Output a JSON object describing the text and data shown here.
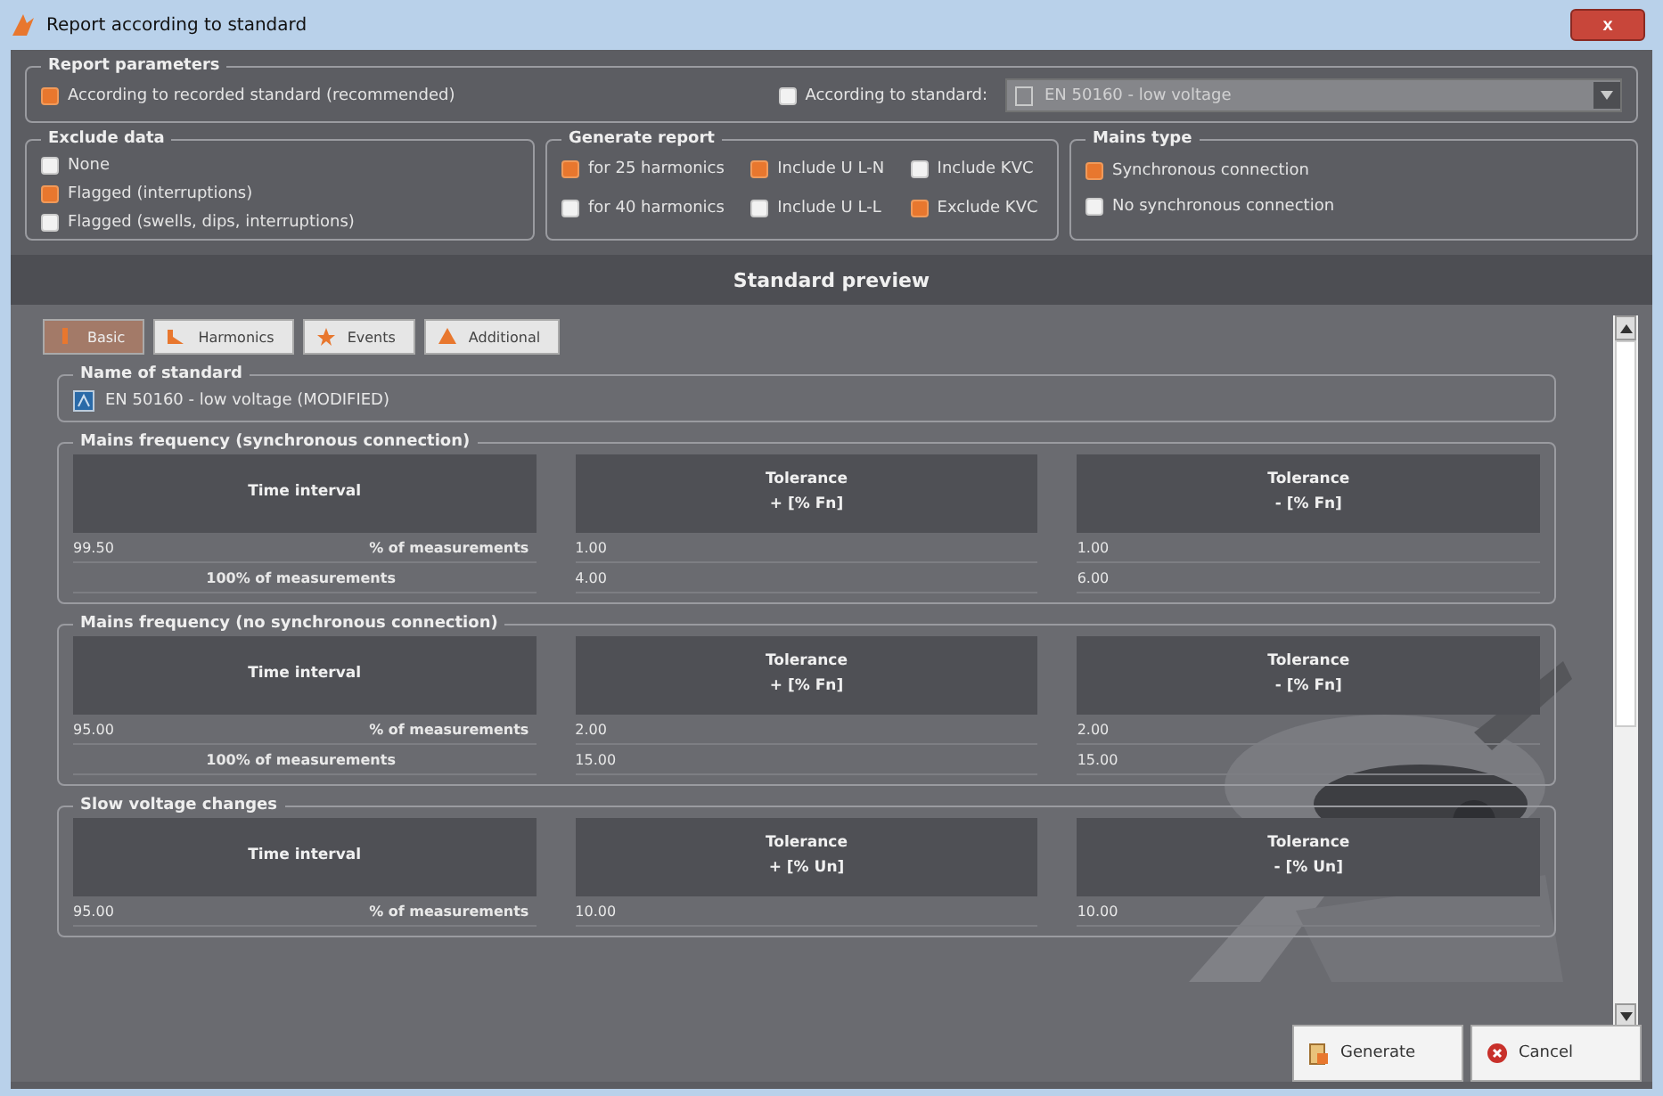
{
  "window": {
    "title": "Report according to standard",
    "close": "x"
  },
  "report_parameters": {
    "title": "Report parameters",
    "options": [
      {
        "label": "According to recorded standard (recommended)",
        "selected": true
      },
      {
        "label": "According to standard:",
        "selected": false
      }
    ],
    "standard_dropdown": {
      "value": "EN 50160 - low voltage",
      "disabled": true
    }
  },
  "exclude_data": {
    "title": "Exclude data",
    "options": [
      {
        "label": "None",
        "checked": false
      },
      {
        "label": "Flagged (interruptions)",
        "checked": true
      },
      {
        "label": "Flagged (swells, dips, interruptions)",
        "checked": false
      }
    ]
  },
  "generate_report": {
    "title": "Generate report",
    "options": [
      {
        "label": "for 25 harmonics",
        "checked": true
      },
      {
        "label": "Include U L-N",
        "checked": true
      },
      {
        "label": "Include KVC",
        "checked": false
      },
      {
        "label": "for 40 harmonics",
        "checked": false
      },
      {
        "label": "Include U L-L",
        "checked": false
      },
      {
        "label": "Exclude KVC",
        "checked": true
      }
    ]
  },
  "mains_type": {
    "title": "Mains type",
    "options": [
      {
        "label": "Synchronous connection",
        "checked": true
      },
      {
        "label": "No synchronous connection",
        "checked": false
      }
    ]
  },
  "preview": {
    "title": "Standard preview",
    "tabs": [
      {
        "label": "Basic",
        "selected": true
      },
      {
        "label": "Harmonics",
        "selected": false
      },
      {
        "label": "Events",
        "selected": false
      },
      {
        "label": "Additional",
        "selected": false
      }
    ],
    "name_of_standard": {
      "title": "Name of standard",
      "value": "EN 50160 - low voltage (MODIFIED)"
    },
    "sections": [
      {
        "title": "Mains frequency (synchronous connection)",
        "headers": [
          "Time interval",
          "Tolerance\n+ [% Fn]",
          "Tolerance\n- [% Fn]"
        ],
        "rows": [
          {
            "interval": "99.50",
            "label": "% of measurements",
            "plus": "1.00",
            "minus": "1.00"
          },
          {
            "label": "100% of measurements",
            "plus": "4.00",
            "minus": "6.00"
          }
        ]
      },
      {
        "title": "Mains frequency (no synchronous connection)",
        "headers": [
          "Time interval",
          "Tolerance\n+ [% Fn]",
          "Tolerance\n- [% Fn]"
        ],
        "rows": [
          {
            "interval": "95.00",
            "label": "% of measurements",
            "plus": "2.00",
            "minus": "2.00"
          },
          {
            "label": "100% of measurements",
            "plus": "15.00",
            "minus": "15.00"
          }
        ]
      },
      {
        "title": "Slow voltage changes",
        "headers": [
          "Time interval",
          "Tolerance\n+ [% Un]",
          "Tolerance\n- [% Un]"
        ],
        "rows": [
          {
            "interval": "95.00",
            "label": "% of measurements",
            "plus": "10.00",
            "minus": "10.00"
          }
        ]
      }
    ]
  },
  "buttons": [
    {
      "label": "Generate",
      "kind": "generate"
    },
    {
      "label": "Cancel",
      "kind": "cancel"
    }
  ]
}
